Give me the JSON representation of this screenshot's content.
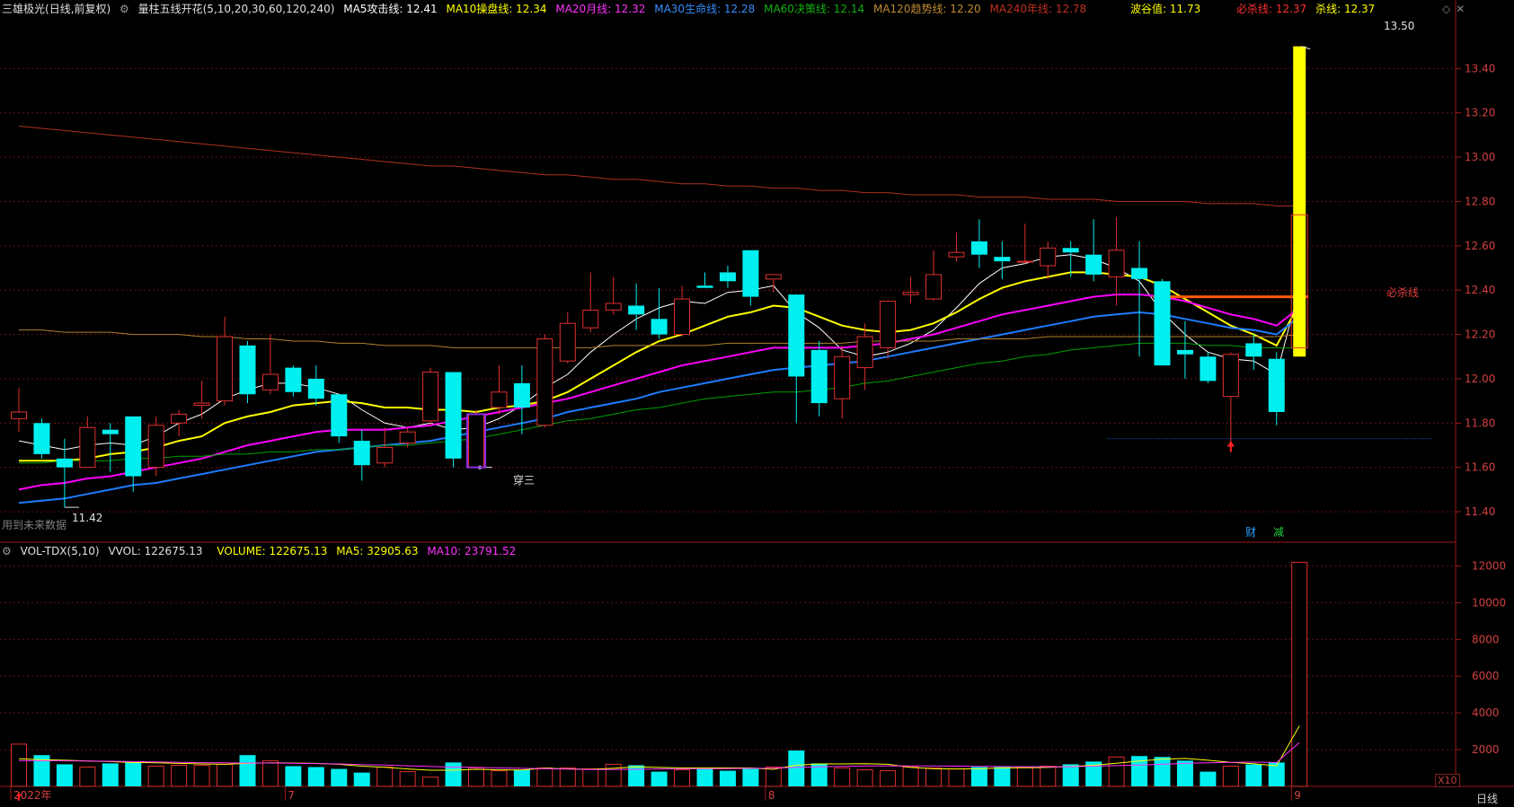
{
  "header": {
    "stock": "三雄极光",
    "period": "(日线,前复权)",
    "indicator": "量柱五线开花(5,10,20,30,60,120,240)",
    "ma5": "MA5攻击线: 12.41",
    "ma10": "MA10操盘线: 12.34",
    "ma20": "MA20月线: 12.32",
    "ma30": "MA30生命线: 12.28",
    "ma60": "MA60决策线: 12.14",
    "ma120": "MA120趋势线: 12.20",
    "ma240": "MA240年线: 12.78",
    "bogu": "波谷值: 11.73",
    "bisha": "必杀线: 12.37",
    "sha": "杀线: 12.37"
  },
  "vol_header": {
    "name": "VOL-TDX(5,10)",
    "vvol": "VVOL: 122675.13",
    "volume": "VOLUME: 122675.13",
    "ma5": "MA5: 32905.63",
    "ma10": "MA10: 23791.52"
  },
  "annotations": {
    "high_price": "13.50",
    "low_price": "11.42",
    "pattern": "穿三",
    "bisha_label": "必杀线",
    "future_note": "用到未来数据",
    "cai": "财",
    "jian": "减",
    "period_btn": "日线",
    "x10": "X10"
  },
  "x_labels": [
    "2022年",
    "7",
    "8",
    "9"
  ],
  "colors": {
    "bg": "#000000",
    "grid": "#6a1010",
    "up": "#e03030",
    "down": "#00f0f0",
    "ma5": "#ffffff",
    "ma10": "#ffff00",
    "ma20": "#ff00ff",
    "ma30": "#1e7cff",
    "ma60": "#00a000",
    "ma120": "#b08030",
    "ma240": "#b03020"
  },
  "chart_data": [
    {
      "type": "candlestick",
      "title": "三雄极光 日线",
      "ylim": [
        11.38,
        13.62
      ],
      "yticks": [
        11.4,
        11.6,
        11.8,
        12.0,
        12.2,
        12.4,
        12.6,
        12.8,
        13.0,
        13.2,
        13.4
      ],
      "candles": [
        {
          "o": 11.82,
          "h": 11.96,
          "l": 11.76,
          "c": 11.85
        },
        {
          "o": 11.8,
          "h": 11.82,
          "l": 11.64,
          "c": 11.66
        },
        {
          "o": 11.64,
          "h": 11.73,
          "l": 11.42,
          "c": 11.6
        },
        {
          "o": 11.6,
          "h": 11.83,
          "l": 11.6,
          "c": 11.78
        },
        {
          "o": 11.77,
          "h": 11.8,
          "l": 11.58,
          "c": 11.75
        },
        {
          "o": 11.83,
          "h": 11.83,
          "l": 11.49,
          "c": 11.56
        },
        {
          "o": 11.6,
          "h": 11.83,
          "l": 11.56,
          "c": 11.79
        },
        {
          "o": 11.8,
          "h": 11.86,
          "l": 11.74,
          "c": 11.84
        },
        {
          "o": 11.88,
          "h": 11.99,
          "l": 11.82,
          "c": 11.89
        },
        {
          "o": 11.9,
          "h": 12.28,
          "l": 11.88,
          "c": 12.19
        },
        {
          "o": 12.15,
          "h": 12.17,
          "l": 11.89,
          "c": 11.93
        },
        {
          "o": 11.95,
          "h": 12.2,
          "l": 11.93,
          "c": 12.02
        },
        {
          "o": 12.05,
          "h": 12.06,
          "l": 11.92,
          "c": 11.94
        },
        {
          "o": 12.0,
          "h": 12.06,
          "l": 11.88,
          "c": 11.91
        },
        {
          "o": 11.93,
          "h": 11.93,
          "l": 11.71,
          "c": 11.74
        },
        {
          "o": 11.72,
          "h": 11.77,
          "l": 11.54,
          "c": 11.61
        },
        {
          "o": 11.62,
          "h": 11.78,
          "l": 11.6,
          "c": 11.69
        },
        {
          "o": 11.71,
          "h": 11.78,
          "l": 11.69,
          "c": 11.76
        },
        {
          "o": 11.81,
          "h": 12.05,
          "l": 11.79,
          "c": 12.03
        },
        {
          "o": 12.03,
          "h": 12.03,
          "l": 11.6,
          "c": 11.64
        },
        {
          "o": 11.6,
          "h": 11.86,
          "l": 11.6,
          "c": 11.84
        },
        {
          "o": 11.87,
          "h": 12.06,
          "l": 11.84,
          "c": 11.94
        },
        {
          "o": 11.98,
          "h": 12.06,
          "l": 11.75,
          "c": 11.87
        },
        {
          "o": 11.79,
          "h": 12.2,
          "l": 11.78,
          "c": 12.18
        },
        {
          "o": 12.08,
          "h": 12.3,
          "l": 12.07,
          "c": 12.25
        },
        {
          "o": 12.23,
          "h": 12.48,
          "l": 12.21,
          "c": 12.31
        },
        {
          "o": 12.31,
          "h": 12.46,
          "l": 12.29,
          "c": 12.34
        },
        {
          "o": 12.33,
          "h": 12.43,
          "l": 12.22,
          "c": 12.29
        },
        {
          "o": 12.27,
          "h": 12.41,
          "l": 12.18,
          "c": 12.2
        },
        {
          "o": 12.2,
          "h": 12.42,
          "l": 12.19,
          "c": 12.36
        },
        {
          "o": 12.42,
          "h": 12.48,
          "l": 12.41,
          "c": 12.41
        },
        {
          "o": 12.48,
          "h": 12.51,
          "l": 12.41,
          "c": 12.44
        },
        {
          "o": 12.58,
          "h": 12.58,
          "l": 12.33,
          "c": 12.37
        },
        {
          "o": 12.45,
          "h": 12.47,
          "l": 12.39,
          "c": 12.47
        },
        {
          "o": 12.38,
          "h": 12.38,
          "l": 11.8,
          "c": 12.01
        },
        {
          "o": 12.13,
          "h": 12.17,
          "l": 11.83,
          "c": 11.89
        },
        {
          "o": 11.91,
          "h": 12.15,
          "l": 11.82,
          "c": 12.1
        },
        {
          "o": 12.05,
          "h": 12.25,
          "l": 11.95,
          "c": 12.19
        },
        {
          "o": 12.14,
          "h": 12.35,
          "l": 12.09,
          "c": 12.35
        },
        {
          "o": 12.38,
          "h": 12.46,
          "l": 12.34,
          "c": 12.39
        },
        {
          "o": 12.36,
          "h": 12.58,
          "l": 12.35,
          "c": 12.47
        },
        {
          "o": 12.55,
          "h": 12.66,
          "l": 12.53,
          "c": 12.57
        },
        {
          "o": 12.62,
          "h": 12.72,
          "l": 12.5,
          "c": 12.56
        },
        {
          "o": 12.55,
          "h": 12.62,
          "l": 12.45,
          "c": 12.53
        },
        {
          "o": 12.53,
          "h": 12.7,
          "l": 12.52,
          "c": 12.53
        },
        {
          "o": 12.51,
          "h": 12.62,
          "l": 12.45,
          "c": 12.59
        },
        {
          "o": 12.59,
          "h": 12.62,
          "l": 12.46,
          "c": 12.57
        },
        {
          "o": 12.56,
          "h": 12.72,
          "l": 12.44,
          "c": 12.47
        },
        {
          "o": 12.46,
          "h": 12.73,
          "l": 12.33,
          "c": 12.58
        },
        {
          "o": 12.5,
          "h": 12.62,
          "l": 12.1,
          "c": 12.45
        },
        {
          "o": 12.44,
          "h": 12.45,
          "l": 12.06,
          "c": 12.06
        },
        {
          "o": 12.13,
          "h": 12.26,
          "l": 12.0,
          "c": 12.11
        },
        {
          "o": 12.1,
          "h": 12.12,
          "l": 11.98,
          "c": 11.99
        },
        {
          "o": 11.92,
          "h": 12.12,
          "l": 11.69,
          "c": 12.11
        },
        {
          "o": 12.16,
          "h": 12.2,
          "l": 12.04,
          "c": 12.1
        },
        {
          "o": 12.09,
          "h": 12.12,
          "l": 11.79,
          "c": 11.85
        },
        {
          "o": 12.14,
          "h": 13.5,
          "l": 12.1,
          "c": 12.74
        }
      ],
      "ma": {
        "MA5": [
          11.72,
          11.7,
          11.68,
          11.7,
          11.71,
          11.7,
          11.74,
          11.8,
          11.84,
          11.91,
          11.95,
          11.98,
          11.98,
          11.96,
          11.93,
          11.86,
          11.8,
          11.78,
          11.8,
          11.77,
          11.78,
          11.82,
          11.88,
          11.96,
          12.02,
          12.12,
          12.2,
          12.27,
          12.32,
          12.35,
          12.34,
          12.39,
          12.4,
          12.42,
          12.3,
          12.23,
          12.13,
          12.1,
          12.12,
          12.16,
          12.22,
          12.32,
          12.43,
          12.5,
          12.52,
          12.55,
          12.56,
          12.54,
          12.5,
          12.44,
          12.3,
          12.2,
          12.12,
          12.09,
          12.08,
          12.02,
          12.41
        ],
        "MA10": [
          11.63,
          11.63,
          11.63,
          11.64,
          11.66,
          11.67,
          11.69,
          11.72,
          11.74,
          11.8,
          11.83,
          11.85,
          11.88,
          11.89,
          11.9,
          11.89,
          11.87,
          11.87,
          11.86,
          11.86,
          11.85,
          11.87,
          11.88,
          11.9,
          11.94,
          12.0,
          12.06,
          12.12,
          12.17,
          12.2,
          12.24,
          12.28,
          12.3,
          12.33,
          12.32,
          12.28,
          12.24,
          12.22,
          12.21,
          12.22,
          12.25,
          12.3,
          12.36,
          12.41,
          12.44,
          12.46,
          12.48,
          12.48,
          12.47,
          12.46,
          12.42,
          12.36,
          12.3,
          12.24,
          12.2,
          12.15,
          12.34
        ],
        "MA20": [
          11.5,
          11.52,
          11.53,
          11.55,
          11.56,
          11.58,
          11.6,
          11.62,
          11.64,
          11.67,
          11.7,
          11.72,
          11.74,
          11.76,
          11.77,
          11.77,
          11.77,
          11.78,
          11.79,
          11.81,
          11.83,
          11.85,
          11.87,
          11.89,
          11.91,
          11.94,
          11.97,
          12.0,
          12.03,
          12.06,
          12.08,
          12.1,
          12.12,
          12.14,
          12.14,
          12.14,
          12.14,
          12.15,
          12.16,
          12.18,
          12.2,
          12.23,
          12.26,
          12.29,
          12.31,
          12.33,
          12.35,
          12.37,
          12.38,
          12.38,
          12.37,
          12.35,
          12.32,
          12.29,
          12.27,
          12.24,
          12.32
        ],
        "MA30": [
          11.44,
          11.45,
          11.46,
          11.48,
          11.5,
          11.52,
          11.53,
          11.55,
          11.57,
          11.59,
          11.61,
          11.63,
          11.65,
          11.67,
          11.68,
          11.69,
          11.7,
          11.71,
          11.72,
          11.74,
          11.76,
          11.78,
          11.8,
          11.82,
          11.85,
          11.87,
          11.89,
          11.91,
          11.94,
          11.96,
          11.98,
          12.0,
          12.02,
          12.04,
          12.05,
          12.06,
          12.07,
          12.08,
          12.1,
          12.12,
          12.14,
          12.16,
          12.18,
          12.2,
          12.22,
          12.24,
          12.26,
          12.28,
          12.29,
          12.3,
          12.29,
          12.27,
          12.25,
          12.23,
          12.22,
          12.2,
          12.28
        ],
        "MA60": [
          11.62,
          11.62,
          11.63,
          11.63,
          11.63,
          11.64,
          11.64,
          11.65,
          11.65,
          11.66,
          11.66,
          11.67,
          11.67,
          11.68,
          11.68,
          11.69,
          11.7,
          11.7,
          11.71,
          11.72,
          11.73,
          11.75,
          11.77,
          11.79,
          11.81,
          11.82,
          11.84,
          11.86,
          11.87,
          11.89,
          11.91,
          11.92,
          11.93,
          11.94,
          11.94,
          11.95,
          11.96,
          11.98,
          11.99,
          12.01,
          12.03,
          12.05,
          12.07,
          12.08,
          12.1,
          12.11,
          12.13,
          12.14,
          12.15,
          12.16,
          12.16,
          12.16,
          12.15,
          12.15,
          12.14,
          12.14,
          12.14
        ],
        "MA120": [
          12.22,
          12.22,
          12.21,
          12.21,
          12.21,
          12.2,
          12.2,
          12.2,
          12.19,
          12.19,
          12.18,
          12.18,
          12.17,
          12.17,
          12.16,
          12.16,
          12.15,
          12.15,
          12.15,
          12.14,
          12.14,
          12.14,
          12.14,
          12.14,
          12.14,
          12.14,
          12.15,
          12.15,
          12.15,
          12.15,
          12.15,
          12.16,
          12.16,
          12.16,
          12.16,
          12.16,
          12.16,
          12.17,
          12.17,
          12.17,
          12.17,
          12.18,
          12.18,
          12.18,
          12.18,
          12.19,
          12.19,
          12.19,
          12.19,
          12.19,
          12.19,
          12.19,
          12.19,
          12.19,
          12.19,
          12.19,
          12.2
        ],
        "MA240": [
          13.14,
          13.13,
          13.12,
          13.11,
          13.1,
          13.09,
          13.08,
          13.07,
          13.06,
          13.05,
          13.04,
          13.03,
          13.02,
          13.01,
          13.0,
          12.99,
          12.98,
          12.97,
          12.96,
          12.96,
          12.95,
          12.94,
          12.93,
          12.92,
          12.92,
          12.91,
          12.9,
          12.9,
          12.89,
          12.88,
          12.88,
          12.87,
          12.87,
          12.86,
          12.86,
          12.85,
          12.85,
          12.84,
          12.84,
          12.83,
          12.83,
          12.83,
          12.82,
          12.82,
          12.82,
          12.81,
          12.81,
          12.81,
          12.8,
          12.8,
          12.8,
          12.8,
          12.79,
          12.79,
          12.79,
          12.78,
          12.78
        ]
      },
      "levels": {
        "bisha": 12.37,
        "bogu": 11.73
      }
    },
    {
      "type": "bar",
      "title": "VOL-TDX(5,10)",
      "unit": "X10",
      "ylim": [
        0,
        13000
      ],
      "yticks": [
        2000,
        4000,
        6000,
        8000,
        10000,
        12000
      ],
      "values": [
        2300,
        1700,
        1200,
        1050,
        1250,
        1300,
        1100,
        1150,
        1150,
        1200,
        1700,
        1400,
        1100,
        1050,
        950,
        750,
        1050,
        800,
        500,
        1300,
        1000,
        850,
        900,
        1000,
        1000,
        950,
        1200,
        1150,
        800,
        900,
        950,
        850,
        950,
        1050,
        1950,
        1250,
        1000,
        900,
        850,
        1050,
        1000,
        950,
        1050,
        1050,
        1050,
        1100,
        1200,
        1350,
        1600,
        1650,
        1600,
        1400,
        800,
        1100,
        1200,
        1300,
        12200
      ],
      "ma5": [
        1500,
        1450,
        1420,
        1380,
        1350,
        1300,
        1280,
        1250,
        1220,
        1200,
        1250,
        1280,
        1270,
        1250,
        1200,
        1100,
        1040,
        950,
        880,
        880,
        930,
        900,
        890,
        990,
        950,
        930,
        980,
        1060,
        1030,
        1000,
        1000,
        1000,
        1000,
        930,
        1150,
        1220,
        1220,
        1230,
        1200,
        1030,
        960,
        950,
        960,
        1000,
        1010,
        1030,
        1080,
        1150,
        1260,
        1380,
        1480,
        1520,
        1420,
        1310,
        1230,
        1120,
        3300
      ],
      "ma10": [
        1400,
        1400,
        1390,
        1380,
        1370,
        1350,
        1330,
        1310,
        1290,
        1280,
        1270,
        1270,
        1260,
        1240,
        1220,
        1190,
        1160,
        1120,
        1080,
        1050,
        1030,
        1000,
        980,
        960,
        940,
        920,
        920,
        930,
        950,
        960,
        960,
        970,
        980,
        990,
        1030,
        1060,
        1090,
        1110,
        1110,
        1110,
        1110,
        1100,
        1090,
        1080,
        1070,
        1060,
        1070,
        1100,
        1130,
        1160,
        1200,
        1250,
        1280,
        1310,
        1320,
        1300,
        2380
      ]
    }
  ]
}
